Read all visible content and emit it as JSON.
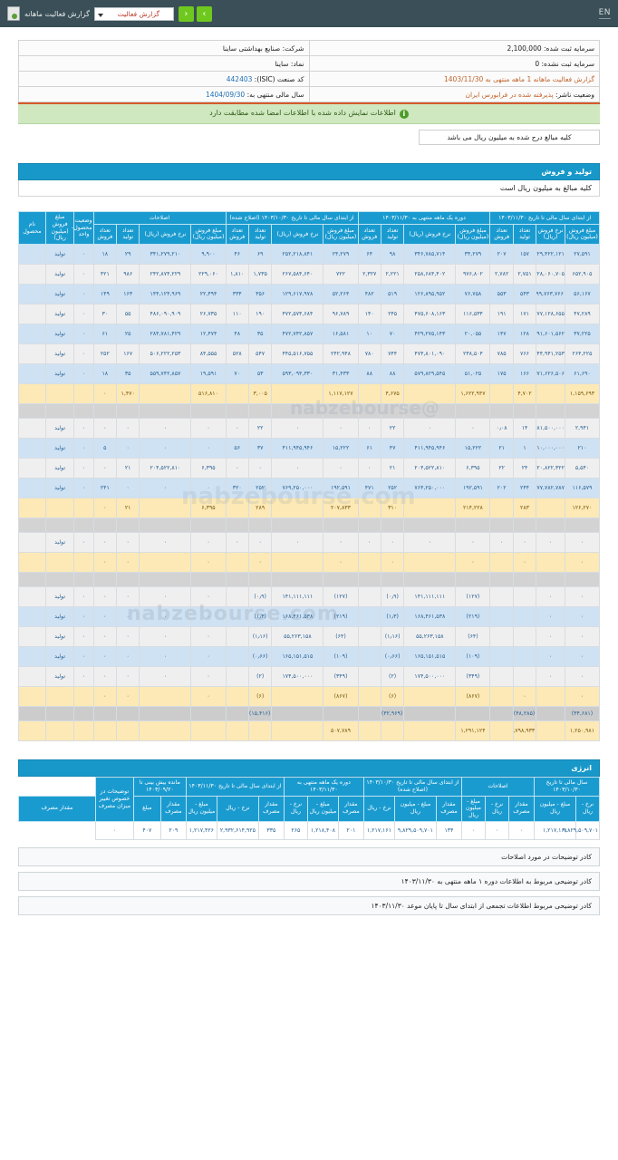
{
  "topbar": {
    "icon": "report-icon",
    "title": "گزارش فعالیت ماهانه",
    "select_value": "گزارش فعالیت",
    "prev_label": "‹",
    "next_label": "›",
    "lang_toggle": "EN",
    "accent_color": "#6ec81e",
    "bar_color": "#3a4f57"
  },
  "info": {
    "company_label": "شرکت: صنایع بهداشتی ساینا",
    "capital_registered_label": "سرمایه ثبت شده:",
    "capital_registered_value": "2,100,000",
    "symbol_label": "نماد: ساینا",
    "capital_unregistered_label": "سرمایه ثبت نشده:",
    "capital_unregistered_value": "0",
    "isic_label": "کد صنعت (ISIC):",
    "isic_value": "442403",
    "period_label": "گزارش فعالیت ماهانه  1 ماهه منتهی به",
    "period_value": "1403/11/30",
    "fiscal_label": "سال مالی منتهی به:",
    "fiscal_value": "1404/09/30",
    "issuer_status_label": "وضعیت ناشر:",
    "issuer_status_value": "پذیرفته شده در فرابورس ایران"
  },
  "notice": {
    "text": "اطلاعات نمایش داده شده با اطلاعات امضا شده مطابقت دارد",
    "icon": "info-icon"
  },
  "unit_note": "کلیه مبالغ درج شده به میلیون ریال می باشد",
  "sections": {
    "production": {
      "title": "تولید و فروش",
      "subtitle": "کلیه مبالغ به میلیون ریال است"
    },
    "energy": {
      "title": "انرژی"
    }
  },
  "grid": {
    "group_headers": [
      "اصلاحات",
      "از ابتدای سال مالی تا تاریخ ۱۴۰۳/۱۰/۳۰ (اصلاح شده)",
      "دوره یک ماهه منتهی به ۱۴۰۳/۱۱/۳۰",
      "از ابتدای سال مالی تا تاریخ ۱۴۰۳/۱۱/۳۰",
      "وضعیت محصول- واحد",
      "نام محصول"
    ],
    "sub_headers": {
      "amount": "مبلغ فروش (میلیون ریال)",
      "rate": "نرخ فروش (ریال)",
      "sales_qty": "تعداد فروش",
      "prod_qty": "تعداد تولید"
    },
    "first_col": "مبلغ فروش (میلیون ریال)",
    "rows": [
      {
        "status": "تولید",
        "c": [
          "۲۷,۵۹۱",
          "۲۲۹,۴۲۲,۱۲۱",
          "۱۵۷",
          "۲۰۷",
          "۳۴,۲۷۹",
          "۳۴۶,۷۸۵,۷۱۴",
          "۹۸",
          "۶۴",
          "۲۴,۲۷۹",
          "۲۵۲,۲۱۸,۸۴۱",
          "۶۹",
          "۴۶",
          "۹,۹۰۰",
          "۳۴۱,۲۷۹,۲۱۰",
          "۲۹",
          "۱۸",
          "۰"
        ],
        "style": "r-blue"
      },
      {
        "status": "تولید",
        "c": [
          "۶۵۲,۹۰۵",
          "۲۲۸,۰۶۰,۷۰۵",
          "۲,۷۵۱",
          "۲,۷۸۲",
          "۹۷۶,۸۰۲",
          "۲۵۸,۶۸۴,۴۰۲",
          "۲,۲۲۱",
          "۲,۳۲۷",
          "۷۲۲",
          "۲۶۷,۵۸۴,۶۴۰",
          "۱,۷۳۵",
          "۱,۸۱۰",
          "۲۲۹,۰۶۰",
          "۲۴۲,۸۷۴,۲۲۹",
          "۹۸۶",
          "۴۲۱",
          "۰"
        ],
        "style": "r-gray"
      },
      {
        "status": "تولید",
        "c": [
          "۵۶,۱۶۷",
          "۹۹,۷۶۳,۷۶۶",
          "۵۴۳",
          "۵۵۳",
          "۷۶,۷۵۸",
          "۱۲۶,۸۹۵,۹۵۲",
          "۵۱۹",
          "۴۸۲",
          "۵۲,۲۶۴",
          "۱۲۹,۶۱۷,۹۷۸",
          "۳۵۶",
          "۳۳۴",
          "۲۲,۴۹۴",
          "۱۴۴,۱۲۴,۹۶۹",
          "۱۶۳",
          "۱۴۹",
          "۰"
        ],
        "style": "r-blue"
      },
      {
        "status": "تولید",
        "c": [
          "۴۷,۲۸۹",
          "۲۷۷,۱۲۸,۶۵۵",
          "۱۷۱",
          "۱۹۱",
          "۱۱۶,۵۳۴",
          "۴۷۵,۶۰۸,۱۶۳",
          "۲۴۵",
          "۱۴۰",
          "۹۶,۷۸۹",
          "۴۷۲,۵۷۴,۶۸۴",
          "۱۹۰",
          "۱۱۰",
          "۲۶,۷۳۵",
          "۴۸۶,۰۹۰,۹۰۹",
          "۵۵",
          "۳۰",
          "۰"
        ],
        "style": "r-gray"
      },
      {
        "status": "تولید",
        "c": [
          "۳۷,۲۲۵",
          "۲۹۱,۶۰۱,۵۶۲",
          "۱۲۸",
          "۱۴۷",
          "۲۰,۰۵۵",
          "۴۲۹,۲۷۵,۱۴۳",
          "۷۰",
          "۱۰",
          "۱۶,۵۸۱",
          "۴۷۲,۷۴۲,۸۵۷",
          "۳۵",
          "۴۸",
          "۱۲,۴۷۴",
          "۲۸۴,۷۸۱,۴۲۹",
          "۲۵",
          "۶۱",
          "۰"
        ],
        "style": "r-blue"
      },
      {
        "status": "تولید",
        "c": [
          "۲۶۴,۲۲۵",
          "۲۴۴,۹۴۱,۲۵۳",
          "۷۶۶",
          "۷۸۵",
          "۲۳۸,۵۰۴",
          "۴۷۴,۸۰۱,۰۹۰",
          "۷۴۴",
          "۷۸۰",
          "۲۴۲,۹۴۸",
          "۴۴۵,۵۱۶,۷۵۵",
          "۵۴۷",
          "۵۲۸",
          "۸۴,۵۵۵",
          "۵۰۶,۲۲۲,۲۵۳",
          "۱۶۷",
          "۲۵۲",
          "۰"
        ],
        "style": "r-gray"
      },
      {
        "status": "تولید",
        "c": [
          "۶۱,۶۹۰",
          "۳۷۱,۶۲۶,۵۰۶",
          "۱۶۶",
          "۱۷۵",
          "۵۱,۰۲۵",
          "۵۷۹,۸۲۹,۵۴۵",
          "۸۸",
          "۸۸",
          "۳۱,۴۳۳",
          "۵۹۳,۰۹۴,۳۳۰",
          "۵۳",
          "۷۰",
          "۱۹,۵۹۱",
          "۵۵۹,۷۴۲,۸۵۷",
          "۳۵",
          "۱۸",
          "۰"
        ],
        "style": "r-blue"
      },
      {
        "status": "",
        "c": [
          "۱,۱۵۹,۶۹۳",
          "",
          "۴,۷۰۲",
          "",
          "۱,۶۲۲,۹۴۷",
          "",
          "۴,۶۷۵",
          "",
          "۱,۱۱۷,۱۲۷",
          "",
          "۳,۰۰۵",
          "",
          "۵۱۶,۸۱۰",
          "",
          "۱,۴۷۰",
          "۰",
          ""
        ],
        "style": "r-tot"
      },
      {
        "status": "",
        "c": [
          "",
          "",
          "",
          "",
          "",
          "",
          "",
          "",
          "",
          "",
          "",
          "",
          "",
          "",
          "",
          "",
          ""
        ],
        "style": "r-band"
      },
      {
        "status": "تولید",
        "c": [
          "۲,۹۴۱",
          "۲۸۱,۵۰۰,۰۰۰",
          "۱۴",
          "۰٫۰۸",
          "۰",
          "۰",
          "۲۲",
          "۰",
          "۰",
          "۰",
          "۲۲",
          "۰",
          "۰",
          "۰",
          "۰",
          "۰",
          "۰"
        ],
        "style": "r-gray"
      },
      {
        "status": "تولید",
        "c": [
          "۲۱۰",
          "۲۱۰,۰۰۰,۰۰۰",
          "۱",
          "۲۱",
          "۱۵,۲۲۲",
          "۴۱۱,۹۴۵,۹۴۶",
          "۴۷",
          "۶۱",
          "۱۵,۲۲۲",
          "۴۱۱,۹۴۵,۹۴۶",
          "۳۷",
          "۵۶",
          "۰",
          "۰",
          "۰",
          "۵",
          "۰"
        ],
        "style": "r-blue"
      },
      {
        "status": "تولید",
        "c": [
          "۵,۵۴۰",
          "۲۲۰,۸۲۲,۳۲۲",
          "۲۴",
          "۲۲",
          "۶,۳۹۵",
          "۲۰۴,۵۲۲,۸۱۰",
          "۲۱",
          "۰",
          "۰",
          "۰",
          "۰",
          "۰",
          "۶,۳۹۵",
          "۲۰۴,۵۲۲,۸۱۰",
          "۲۱",
          "۰",
          "۰"
        ],
        "style": "r-gray"
      },
      {
        "status": "تولید",
        "c": [
          "۱۱۶,۵۷۹",
          "۷۷۷,۷۸۲,۷۸۷",
          "۲۴۴",
          "۲۰۲",
          "۱۹۲,۵۹۱",
          "۷۶۴,۲۵۰,۰۰۰",
          "۲۵۲",
          "۴۷۱",
          "۱۹۲,۵۹۱",
          "۷۶۹,۲۵۰,۰۰۰",
          "۲۵۲",
          "۳۲۰",
          "۰",
          "۰",
          "۰",
          "۲۴۱",
          "۰"
        ],
        "style": "r-blue"
      },
      {
        "status": "",
        "c": [
          "۱۲۶,۲۷۰",
          "",
          "۲۸۳",
          "",
          "۲۱۴,۲۲۸",
          "",
          "۳۱۰",
          "",
          "۲۰۷,۸۳۳",
          "",
          "۲۸۹",
          "",
          "۶,۳۹۵",
          "",
          "۲۱",
          "۰",
          ""
        ],
        "style": "r-tot"
      },
      {
        "status": "",
        "c": [
          "",
          "",
          "",
          "",
          "",
          "",
          "",
          "",
          "",
          "",
          "",
          "",
          "",
          "",
          "",
          "",
          ""
        ],
        "style": "r-band"
      },
      {
        "status": "تولید",
        "c": [
          "۰",
          "۰",
          "۰",
          "۰",
          "۰",
          "۰",
          "۰",
          "۰",
          "۰",
          "۰",
          "۰",
          "۰",
          "۰",
          "۰",
          "۰",
          "۰",
          "۰"
        ],
        "style": "r-gray"
      },
      {
        "status": "",
        "c": [
          "۰",
          "",
          "۰",
          "",
          "۰",
          "",
          "۰",
          "",
          "۰",
          "",
          "۰",
          "",
          "۰",
          "",
          "۰",
          "۰",
          ""
        ],
        "style": "r-tot"
      },
      {
        "status": "",
        "c": [
          "",
          "",
          "",
          "",
          "",
          "",
          "",
          "",
          "",
          "",
          "",
          "",
          "",
          "",
          "",
          "",
          ""
        ],
        "style": "r-band"
      },
      {
        "status": "تولید",
        "c": [
          "۰",
          "۰",
          "",
          "",
          "(۱۲۷)",
          "۱۴۱,۱۱۱,۱۱۱",
          "(۰٫۹)",
          "",
          "(۱۲۷)",
          "۱۴۱,۱۱۱,۱۱۱",
          "(۰٫۹)",
          "",
          "۰",
          "۰",
          "۰",
          "۰",
          "۰"
        ],
        "style": "r-gray",
        "neg_idx": [
          4,
          6,
          8,
          10
        ]
      },
      {
        "status": "تولید",
        "c": [
          "۰",
          "۰",
          "",
          "",
          "(۲۱۹)",
          "۱۶۸,۴۶۱,۵۳۸",
          "(۱٫۳)",
          "",
          "(۲۱۹)",
          "۱۶۸,۴۶۱,۵۳۸",
          "(۱٫۳)",
          "",
          "۰",
          "۰",
          "۰",
          "۰",
          "۰"
        ],
        "style": "r-blue",
        "neg_idx": [
          4,
          6,
          8,
          10
        ]
      },
      {
        "status": "تولید",
        "c": [
          "۰",
          "۰",
          "",
          "",
          "(۶۴)",
          "۵۵,۲۶۳,۱۵۸",
          "(۱٫۱۶)",
          "",
          "(۶۴)",
          "۵۵,۲۶۳,۱۵۸",
          "(۱٫۱۶)",
          "",
          "۰",
          "۰",
          "۰",
          "۰",
          "۰"
        ],
        "style": "r-gray",
        "neg_idx": [
          4,
          6,
          8,
          10
        ]
      },
      {
        "status": "تولید",
        "c": [
          "۰",
          "۰",
          "",
          "",
          "(۱۰۹)",
          "۱۶۵,۱۵۱,۵۱۵",
          "(۰٫۶۶)",
          "",
          "(۱۰۹)",
          "۱۶۵,۱۵۱,۵۱۵",
          "(۰٫۶۶)",
          "",
          "۰",
          "۰",
          "۰",
          "۰",
          "۰"
        ],
        "style": "r-blue",
        "neg_idx": [
          4,
          6,
          8,
          10
        ]
      },
      {
        "status": "تولید",
        "c": [
          "۰",
          "۰",
          "",
          "",
          "(۳۴۹)",
          "۱۷۴,۵۰۰,۰۰۰",
          "(۲)",
          "",
          "(۳۴۹)",
          "۱۷۴,۵۰۰,۰۰۰",
          "(۲)",
          "",
          "۰",
          "۰",
          "۰",
          "۰",
          "۰"
        ],
        "style": "r-gray",
        "neg_idx": [
          4,
          6,
          8,
          10
        ]
      },
      {
        "status": "",
        "c": [
          "۰",
          "",
          "۰",
          "",
          "(۸۶۷)",
          "",
          "(۶)",
          "",
          "(۸۶۷)",
          "",
          "(۶)",
          "",
          "۰",
          "",
          "۰",
          "۰",
          ""
        ],
        "style": "r-tot",
        "neg_idx": [
          4,
          6,
          8,
          10
        ]
      },
      {
        "status": "",
        "c": [
          "(۳۴,۶۸۱)",
          "",
          "(۴۸,۲۸۵)",
          "",
          "",
          "",
          "(۳۲,۹۶۹)",
          "",
          "",
          "",
          "(۱۵,۴۱۶)",
          "",
          "",
          "",
          "",
          "",
          ""
        ],
        "style": "r-sub",
        "neg_idx": [
          0,
          2,
          6,
          10
        ]
      },
      {
        "status": "",
        "c": [
          "۱,۲۵۰,۹۸۱",
          "",
          "۱,۷۹۸,۹۳۳",
          "",
          "۱,۲۹۱,۱۲۴",
          "",
          "",
          "",
          "۵۰۷,۷۸۹",
          "",
          "",
          "",
          "",
          "",
          "",
          "",
          ""
        ],
        "style": "r-tot"
      }
    ]
  },
  "energy": {
    "group_headers": [
      "سال مالی تا تاریخ ۱۴۰۳/۱۰/۳۰",
      "اصلاحات",
      "از ابتدای سال مالی تا تاریخ ۱۴۰۳/۱۰/۳۰ (اصلاح شده)",
      "دوره یک ماهه منتهی به ۱۴۰۳/۱۱/۳۰",
      "از ابتدای سال مالی تا تاریخ ۱۴۰۳/۱۱/۳۰",
      "مانده بیش بینی تا ۱۴۰۳/۰۹/۲۰",
      "توضیحات در خصوص تغییر میزان مصرف"
    ],
    "sub_headers": {
      "rate_rial": "نرخ - ریال",
      "amount_m": "مبلغ - میلیون ریال",
      "qty": "مقدار مصرف",
      "amount": "مبلغ",
      "qty2": "مقدار",
      "desc": "مقدار مصرف"
    },
    "row": [
      "۹,۸۲۹,۵۰۹,۷۰۱",
      "۱,۲۱۷,۱۶۱",
      "۰",
      "۰",
      "۰",
      "۱۳۴",
      "۹,۸۲۹,۵۰۹,۷۰۱",
      "۱,۲۱۷,۱۶۱",
      "۲۰۱",
      "۱,۲۱۸,۴۰۸",
      "۲۶۵",
      "۳۳۵",
      "۲,۹۳۲,۶۱۴,۹۲۵",
      "۱,۲۱۷,۴۲۶",
      "۲۰۹",
      "۴۰۷",
      "۰"
    ]
  },
  "footer": {
    "note1": "کادر توضیحات در مورد اصلاحات",
    "note2": "کادر توضیحی مربوط به اطلاعات دوره ۱ ماهه منتهی به ۱۴۰۳/۱۱/۳۰",
    "note3": "کادر توضیحی مربوط اطلاعات تجمعی از ابتدای سال تا پایان موعد ۱۴۰۳/۱۱/۳۰"
  },
  "watermark": {
    "site": "nabzebourse.com",
    "handle": "@nabzebourse"
  }
}
